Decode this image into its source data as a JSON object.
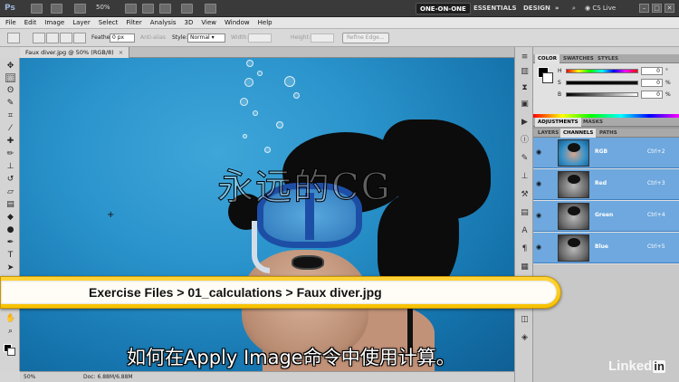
{
  "app": {
    "logo": "Ps",
    "zoom": "50%",
    "workspaces": [
      "ONE-ON-ONE",
      "ESSENTIALS",
      "DESIGN"
    ],
    "more": "»",
    "cs_live": "CS Live",
    "window_buttons": [
      "–",
      "□",
      "✕"
    ]
  },
  "menu": [
    "File",
    "Edit",
    "Image",
    "Layer",
    "Select",
    "Filter",
    "Analysis",
    "3D",
    "View",
    "Window",
    "Help"
  ],
  "options": {
    "feather_label": "Feather:",
    "feather_value": "0 px",
    "antialias_label": "Anti-alias",
    "style_label": "Style:",
    "style_value": "Normal",
    "width_label": "Width:",
    "height_label": "Height:",
    "refine_edge": "Refine Edge..."
  },
  "document": {
    "tab_title": "Faux diver.jpg @ 50% (RGB/8)",
    "close": "×"
  },
  "status": {
    "zoom": "50%",
    "doc_info": "Doc: 6.88M/6.88M"
  },
  "panels": {
    "color_tabs": [
      "COLOR",
      "SWATCHES",
      "STYLES"
    ],
    "color_rows": [
      {
        "label": "H",
        "value": "0",
        "unit": "°"
      },
      {
        "label": "S",
        "value": "0",
        "unit": "%"
      },
      {
        "label": "B",
        "value": "0",
        "unit": "%"
      }
    ],
    "adjust_tabs": [
      "ADJUSTMENTS",
      "MASKS"
    ],
    "layer_tabs": [
      "LAYERS",
      "CHANNELS",
      "PATHS"
    ],
    "channels": [
      {
        "name": "RGB",
        "shortcut": "Ctrl+2"
      },
      {
        "name": "Red",
        "shortcut": "Ctrl+3"
      },
      {
        "name": "Green",
        "shortcut": "Ctrl+4"
      },
      {
        "name": "Blue",
        "shortcut": "Ctrl+5"
      }
    ]
  },
  "overlay": {
    "breadcrumb": "Exercise Files > 01_calculations > Faux diver.jpg",
    "watermark": "永远的CG",
    "subtitle": "如何在Apply Image命令中使用计算。",
    "brand": "Linked",
    "brand_in": "in"
  },
  "colors": {
    "accent": "#6ea8de",
    "banner": "#f7c200",
    "appbar": "#3a3a3a"
  }
}
